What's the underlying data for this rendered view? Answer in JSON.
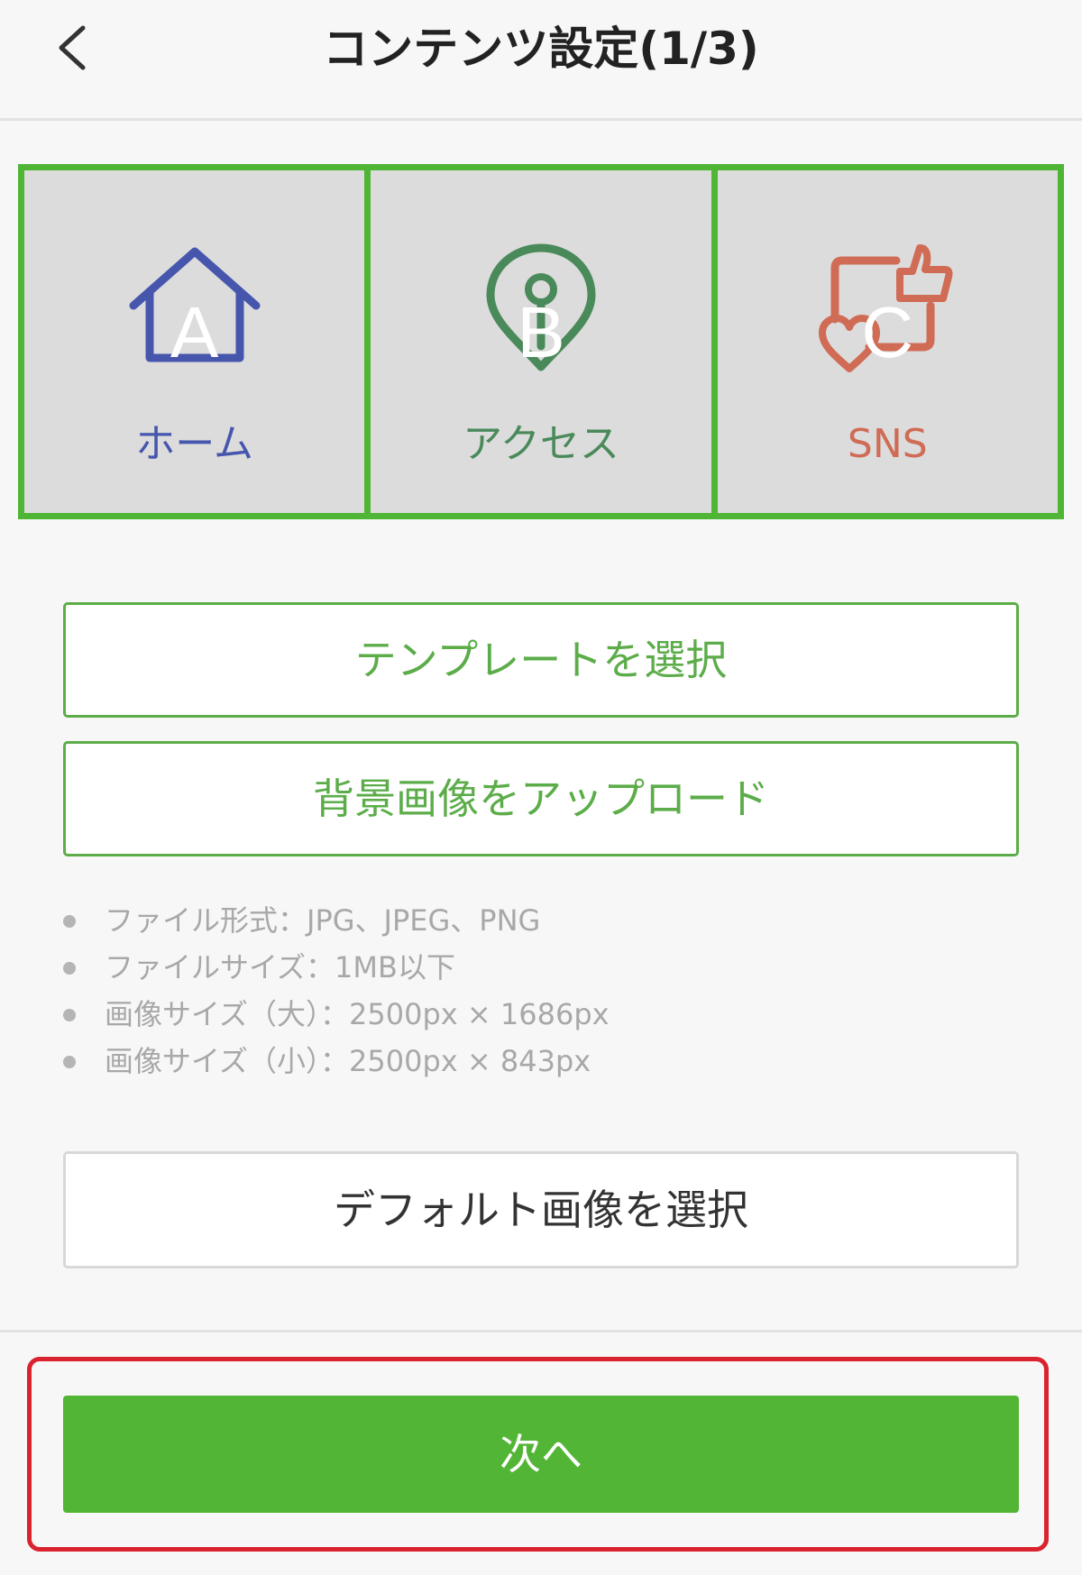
{
  "header": {
    "title": "コンテンツ設定(1/3)",
    "back_icon": "chevron-left-icon"
  },
  "tabs": [
    {
      "label": "ホーム",
      "letter": "A",
      "icon": "house-icon",
      "color": "#4656ad"
    },
    {
      "label": "アクセス",
      "letter": "B",
      "icon": "map-pin-icon",
      "color": "#4a8a5a"
    },
    {
      "label": "SNS",
      "letter": "C",
      "icon": "social-like-heart-icon",
      "color": "#d06b55"
    }
  ],
  "actions": {
    "template_label": "テンプレートを選択",
    "upload_label": "背景画像をアップロード",
    "default_label": "デフォルト画像を選択",
    "next_label": "次へ"
  },
  "specs": [
    "ファイル形式：JPG、JPEG、PNG",
    "ファイルサイズ：1MB以下",
    "画像サイズ（大）：2500px × 1686px",
    "画像サイズ（小）：2500px × 843px"
  ],
  "colors": {
    "accent_green": "#53b536",
    "highlight_red": "#d9232e",
    "tab_background": "#dcdcdc"
  }
}
